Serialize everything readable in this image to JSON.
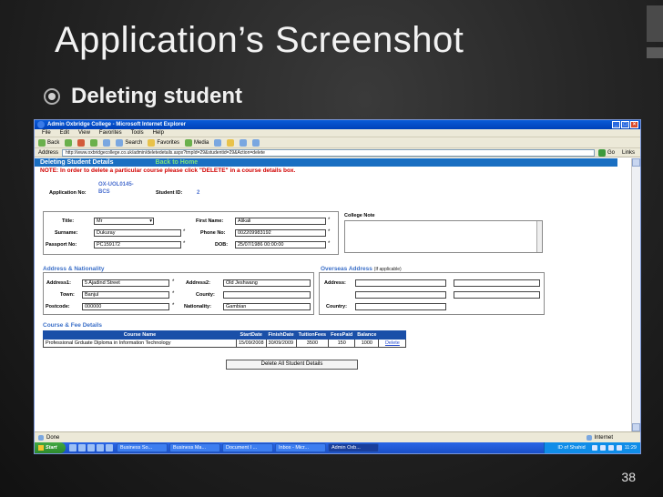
{
  "slide": {
    "title": "Application’s Screenshot",
    "bullet": "Deleting student",
    "page_number": "38"
  },
  "window": {
    "title": "Admin Oxbridge College - Microsoft Internet Explorer",
    "menu": [
      "File",
      "Edit",
      "View",
      "Favorites",
      "Tools",
      "Help"
    ],
    "toolbar": {
      "back": "Back",
      "search": "Search",
      "favorites": "Favorites",
      "media": "Media"
    },
    "address_label": "Address",
    "address": "http://www.oxbridgecollege.co.uk/admin/deletedetails.aspx?tmpId=29&studentid=29&Action=delete",
    "go": "Go",
    "links": "Links"
  },
  "page": {
    "header": "Deleting Student Details",
    "back_home": "Back to Home",
    "note": "NOTE: In order to delete a particular course please click \"DELETE\" in a course details box.",
    "application_no_label": "Application No:",
    "application_no": "OX-UOL0145-BCS",
    "student_id_label": "Student ID:",
    "student_id": "2",
    "personal": {
      "title_label": "Title:",
      "title": "Mr",
      "first_name_label": "First Name:",
      "first_name": "Alikali",
      "surname_label": "Surname:",
      "surname": "Dukuray",
      "phone_label": "Phone No:",
      "phone": "002209983192",
      "passport_label": "Passport No:",
      "passport": "PC159172",
      "dob_label": "DOB:",
      "dob": "25/07/1986 00:00:00"
    },
    "college_note_label": "College Note",
    "address_section": "Address & Nationality",
    "address": {
      "address1_label": "Address1:",
      "address1": "5 Ajadind Street",
      "address2_label": "Address2:",
      "address2": "Old Jeshwang",
      "town_label": "Town:",
      "town": "Banjul",
      "county_label": "County:",
      "county": "",
      "postcode_label": "Postcode:",
      "postcode": "000000",
      "nationality_label": "Nationality:",
      "nationality": "Gambian"
    },
    "overseas_section": "Overseas Address",
    "overseas_note": "(If applicable)",
    "overseas": {
      "address_label": "Address:",
      "country_label": "Country:"
    },
    "course_section": "Course & Fee Details",
    "course_columns": [
      "Course Name",
      "StartDate",
      "FinishDate",
      "TuitionFees",
      "FeesPaid",
      "Balance",
      ""
    ],
    "course_rows": [
      [
        "Professional Grduate Diploma in Information Technology",
        "15/09/2008",
        "30/09/2009",
        "3500",
        "150",
        "1000",
        "Delete"
      ]
    ],
    "delete_all": "Delete All Student Details"
  },
  "statusbar": {
    "left": "Done",
    "zone": "Internet"
  },
  "taskbar": {
    "start": "Start",
    "tasks": [
      "Business So...",
      "Business Ma...",
      "Document I ...",
      "Inbox - Micr...",
      "Admin Oxb..."
    ],
    "tray_text": "ID of Shahid",
    "clock": "11:29"
  }
}
